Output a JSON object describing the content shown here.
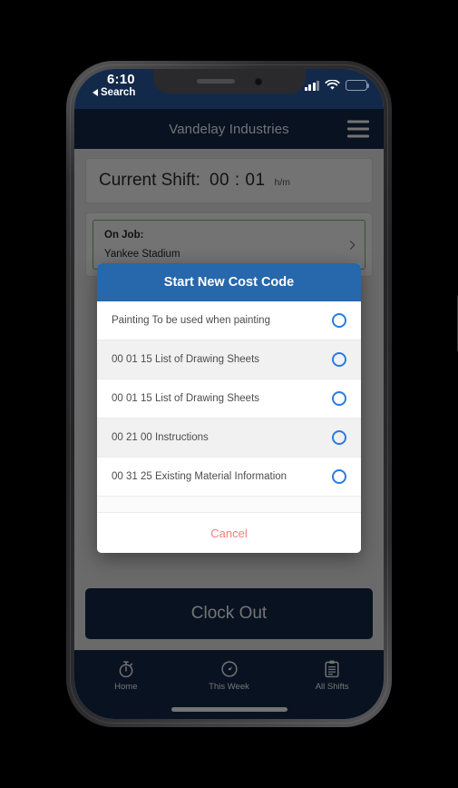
{
  "status_bar": {
    "time": "6:10",
    "back_label": "Search",
    "signal_icon": "cellular-signal-icon",
    "wifi_icon": "wifi-icon",
    "battery_icon": "battery-low-power-icon",
    "battery_color": "#fbc623"
  },
  "nav": {
    "title": "Vandelay Industries",
    "menu_icon": "hamburger-menu-icon"
  },
  "shift": {
    "label": "Current Shift:",
    "time": "00 : 01",
    "unit": "h/m"
  },
  "job": {
    "label": "On Job:",
    "value": "Yankee Stadium",
    "chevron_icon": "chevron-right-icon",
    "border_color": "#79b473"
  },
  "action_sheet": {
    "title": "Start New Cost Code",
    "header_color": "#2767ab",
    "radio_color": "#2a7ae2",
    "options": [
      {
        "label": "Painting To be used when painting"
      },
      {
        "label": "00 01 15 List of Drawing Sheets"
      },
      {
        "label": "00 01 15 List of Drawing Sheets"
      },
      {
        "label": "00 21 00 Instructions"
      },
      {
        "label": "00 31 25 Existing Material Information"
      }
    ],
    "cancel_label": "Cancel",
    "cancel_color": "#f08080"
  },
  "clock_out": {
    "label": "Clock Out",
    "color": "#13294a"
  },
  "tab_bar": {
    "items": [
      {
        "label": "Home",
        "icon": "stopwatch-icon"
      },
      {
        "label": "This Week",
        "icon": "gauge-icon"
      },
      {
        "label": "All Shifts",
        "icon": "clipboard-icon"
      }
    ]
  }
}
